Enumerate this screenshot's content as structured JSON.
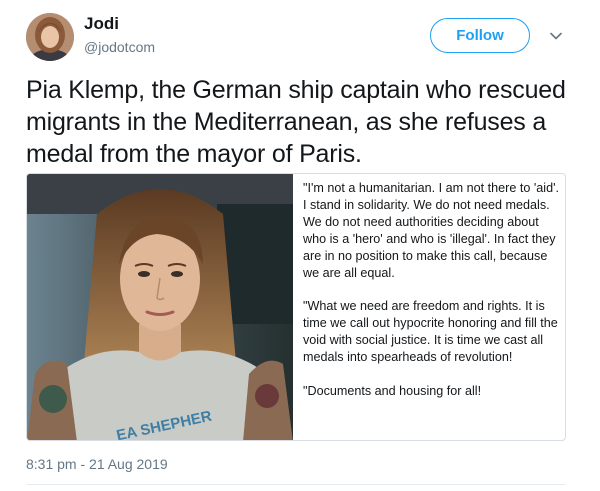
{
  "user": {
    "name": "Jodi",
    "handle": "@jodotcom"
  },
  "follow_button": {
    "label": "Follow"
  },
  "more_menu": {
    "icon": "chevron-down-icon"
  },
  "tweet": {
    "text": "Pia Klemp, the German ship captain who rescued migrants in the Mediterranean, as she refuses a medal from the mayor of Paris.",
    "timestamp": "8:31 pm - 21 Aug 2019"
  },
  "media": {
    "shirt_text": "EA SHEPHER",
    "quote_paragraphs": [
      "\"I'm not a humanitarian. I am not there to 'aid'. I stand in solidarity. We do not need medals. We do not need authorities deciding about who is a 'hero' and who is 'illegal'. In fact they are in no position to make this call, because we are all equal.",
      "\"What we need are freedom and rights. It is time we call out hypocrite honoring and fill the void with social justice. It is time we cast all medals into spearheads of revolution!",
      "\"Documents and housing for all!"
    ]
  },
  "colors": {
    "accent": "#1da1f2",
    "text": "#14171a",
    "secondary": "#657786"
  }
}
